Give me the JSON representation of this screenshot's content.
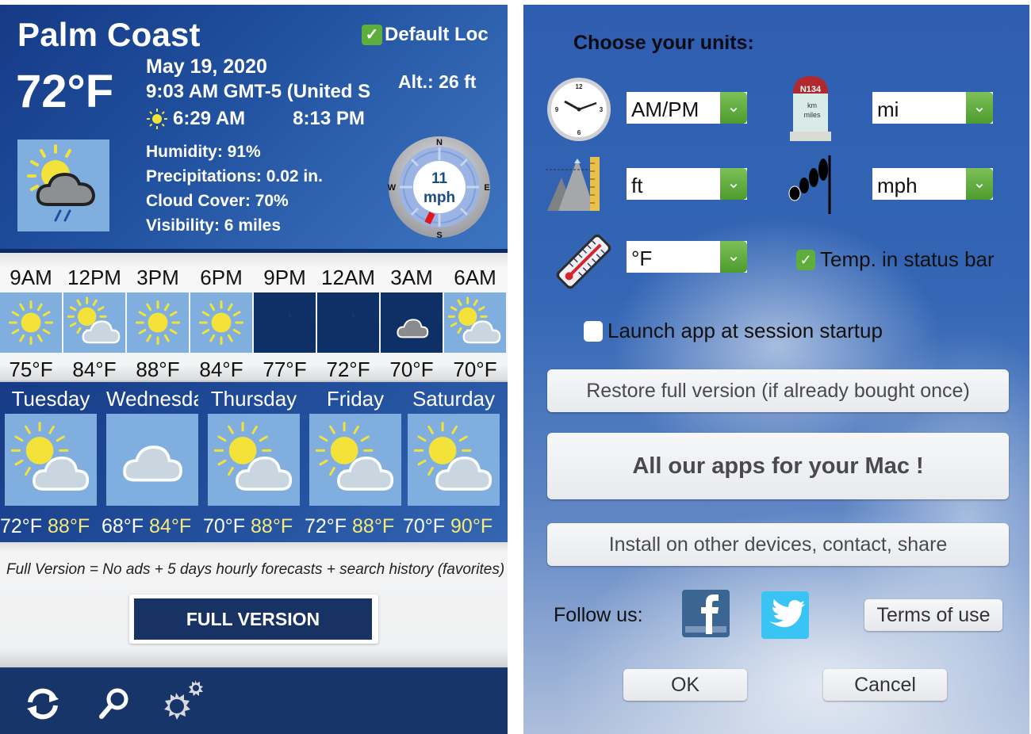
{
  "weather": {
    "city": "Palm Coast",
    "default_loc_label": "Default Loc",
    "default_loc_checked": true,
    "current_temp": "72°F",
    "date": "May 19, 2020",
    "time": "9:03 AM GMT-5 (United S",
    "sunrise": "6:29 AM",
    "sunset": "8:13 PM",
    "altitude": "Alt.: 26 ft",
    "current_condition_icon": "partly-sunny-rain-icon",
    "details": {
      "humidity": "Humidity: 91%",
      "precipitations": "Precipitations: 0.02 in.",
      "cloud_cover": "Cloud Cover: 70%",
      "visibility": "Visibility: 6 miles"
    },
    "wind": {
      "speed": "11",
      "unit": "mph",
      "direction_from": "SSW",
      "compass": {
        "n": "N",
        "e": "E",
        "s": "S",
        "w": "W"
      }
    },
    "hourly": [
      {
        "time": "9AM",
        "temp": "75°F",
        "icon": "sun",
        "night": false
      },
      {
        "time": "12PM",
        "temp": "84°F",
        "icon": "sun-cloud",
        "night": false
      },
      {
        "time": "3PM",
        "temp": "88°F",
        "icon": "sun",
        "night": false
      },
      {
        "time": "6PM",
        "temp": "84°F",
        "icon": "sun",
        "night": false
      },
      {
        "time": "9PM",
        "temp": "77°F",
        "icon": "moon",
        "night": true
      },
      {
        "time": "12AM",
        "temp": "72°F",
        "icon": "moon",
        "night": true
      },
      {
        "time": "3AM",
        "temp": "70°F",
        "icon": "moon-cloud",
        "night": true
      },
      {
        "time": "6AM",
        "temp": "70°F",
        "icon": "sun-cloud",
        "night": false
      }
    ],
    "daily": [
      {
        "day": "Tuesday",
        "low": "72°F",
        "high": "88°F",
        "icon": "sun-cloud"
      },
      {
        "day": "Wednesday",
        "low": "68°F",
        "high": "84°F",
        "icon": "cloud"
      },
      {
        "day": "Thursday",
        "low": "70°F",
        "high": "88°F",
        "icon": "sun-cloud"
      },
      {
        "day": "Friday",
        "low": "72°F",
        "high": "88°F",
        "icon": "sun-cloud"
      },
      {
        "day": "Saturday",
        "low": "70°F",
        "high": "90°F",
        "icon": "sun-cloud"
      }
    ],
    "promo_text": "Full Version = No ads + 5 days hourly forecasts + search history (favorites)",
    "full_version_button": "FULL VERSION",
    "toolbar": [
      "refresh-icon",
      "search-icon",
      "settings-icon"
    ]
  },
  "settings": {
    "title": "Choose your units:",
    "time_format": {
      "value": "AM/PM",
      "icon": "clock-icon"
    },
    "distance": {
      "value": "mi",
      "icon": "milestone-icon",
      "milestone_code": "N134",
      "milestone_text1": "km",
      "milestone_text2": "miles"
    },
    "altitude": {
      "value": "ft",
      "icon": "mountain-ruler-icon"
    },
    "wind_speed": {
      "value": "mph",
      "icon": "windsock-icon"
    },
    "temperature": {
      "value": "°F",
      "icon": "thermometer-icon"
    },
    "temp_in_status_bar": {
      "label": "Temp. in status bar",
      "checked": true
    },
    "launch_at_startup": {
      "label": "Launch app at session startup",
      "checked": false
    },
    "restore_button": "Restore full version (if already bought once)",
    "all_apps_button": "All our apps for your Mac !",
    "install_button": "Install on other devices, contact, share",
    "follow_label": "Follow us:",
    "terms_button": "Terms of use",
    "ok_button": "OK",
    "cancel_button": "Cancel"
  },
  "colors": {
    "weather_blue": "#1f4f9d",
    "tile_day": "#80aede",
    "tile_night": "#0e3066",
    "high_temp_yellow": "#f4e97a",
    "toolbar_navy": "#173569",
    "checkbox_green": "#5fae3c",
    "facebook": "#3b6592",
    "twitter": "#39c4f4"
  }
}
